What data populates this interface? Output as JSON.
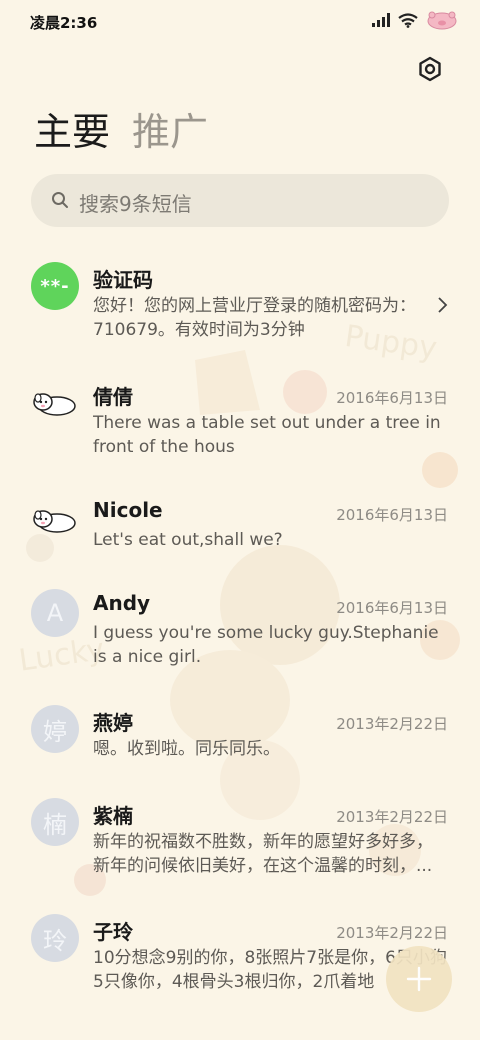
{
  "status_bar": {
    "time": "凌晨2:36",
    "icons": [
      "signal-icon",
      "wifi-icon",
      "battery-pig-icon"
    ]
  },
  "settings": {
    "icon": "gear-icon"
  },
  "tabs": [
    {
      "label": "主要",
      "active": true
    },
    {
      "label": "推广",
      "active": false
    }
  ],
  "search": {
    "placeholder": "搜索9条短信",
    "icon": "search-icon"
  },
  "conversations": [
    {
      "avatar": "**-",
      "avatar_color": "#5fd45b",
      "name": "验证码",
      "date": "",
      "preview": "您好！您的网上营业厅登录的随机密码为：710679。有效时间为3分钟"
    },
    {
      "avatar": "puppy-avatar",
      "name": "倩倩",
      "date": "2016年6月13日",
      "preview": "There was a table set out under a tree in front of the hous"
    },
    {
      "avatar": "puppy-avatar",
      "name": "Nicole",
      "date": "2016年6月13日",
      "preview": "Let's eat out,shall we?"
    },
    {
      "avatar": "A",
      "name": "Andy",
      "date": "2016年6月13日",
      "preview": "I guess you're some lucky guy.Stephanie is a nice girl."
    },
    {
      "avatar": "婷",
      "name": "燕婷",
      "date": "2013年2月22日",
      "preview": "嗯。收到啦。同乐同乐。"
    },
    {
      "avatar": "楠",
      "name": "紫楠",
      "date": "2013年2月22日",
      "preview": "新年的祝福数不胜数，新年的愿望好多好多，新年的问候依旧美好，在这个温馨的时刻，..."
    },
    {
      "avatar": "玲",
      "name": "子玲",
      "date": "2013年2月22日",
      "preview": "10分想念9别的你，8张照片7张是你，6只小狗5只像你，4根骨头3根归你，2爪着地"
    }
  ],
  "fab": {
    "icon": "plus-icon"
  },
  "background_watermarks": [
    "Puppy",
    "Lucky"
  ]
}
